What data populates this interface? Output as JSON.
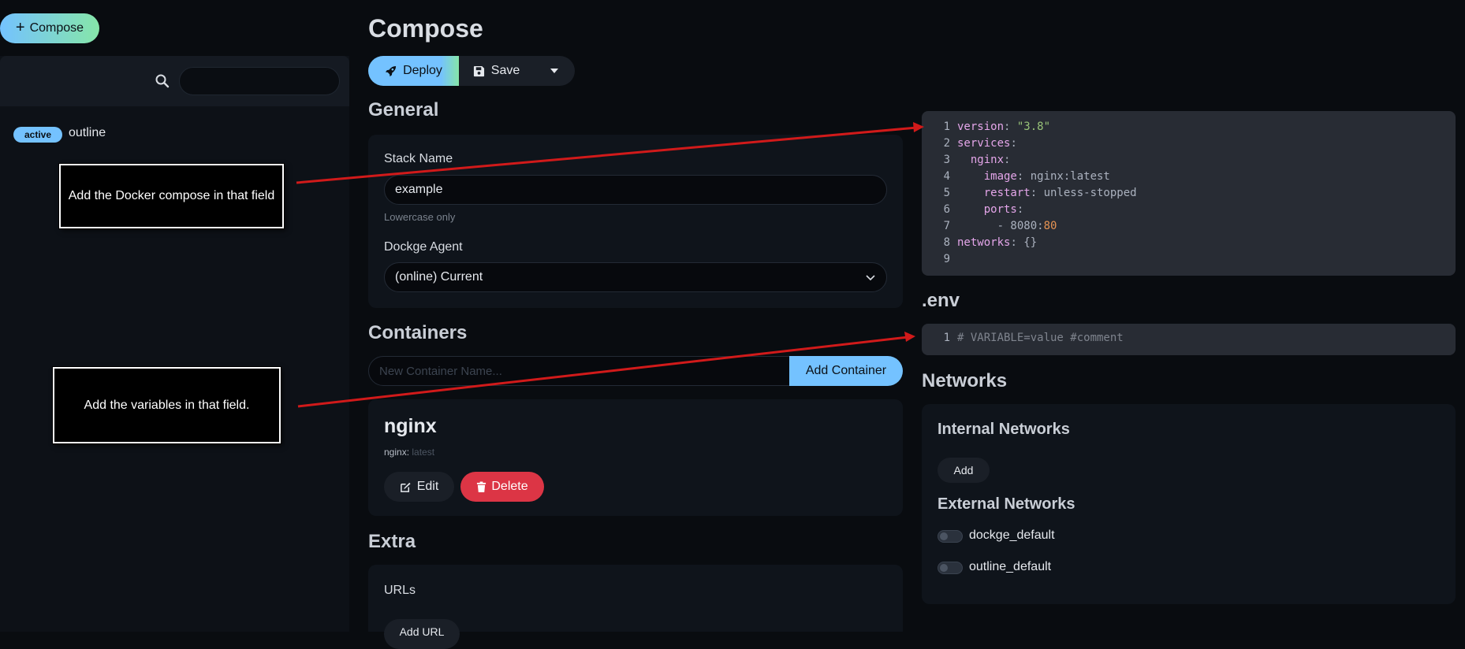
{
  "sidebar": {
    "compose_label": "Compose",
    "search_placeholder": "",
    "stacks": [
      {
        "status": "active",
        "name": "outline"
      }
    ]
  },
  "annotations": {
    "compose_note": "Add the Docker compose in that field",
    "env_note": "Add the variables in that field."
  },
  "main": {
    "title": "Compose",
    "toolbar": {
      "deploy_label": "Deploy",
      "save_label": "Save"
    },
    "general": {
      "title": "General",
      "stack_name_label": "Stack Name",
      "stack_name_value": "example",
      "stack_name_hint": "Lowercase only",
      "agent_label": "Dockge Agent",
      "agent_value": "(online) Current"
    },
    "containers": {
      "title": "Containers",
      "new_placeholder": "New Container Name...",
      "add_label": "Add Container",
      "items": [
        {
          "name": "nginx",
          "image_name": "nginx:",
          "image_tag": "latest",
          "edit_label": "Edit",
          "delete_label": "Delete"
        }
      ]
    },
    "extra": {
      "title": "Extra",
      "urls_label": "URLs",
      "add_url_label": "Add URL"
    }
  },
  "editor": {
    "line_numbers": [
      "1",
      "2",
      "3",
      "4",
      "5",
      "6",
      "7",
      "8",
      "9"
    ],
    "lines": [
      [
        {
          "t": "version",
          "c": "k"
        },
        {
          "t": ": ",
          "c": "p"
        },
        {
          "t": "\"3.8\"",
          "c": "s"
        }
      ],
      [
        {
          "t": "services",
          "c": "k"
        },
        {
          "t": ":",
          "c": "p"
        }
      ],
      [
        {
          "t": "  nginx",
          "c": "k"
        },
        {
          "t": ":",
          "c": "p"
        }
      ],
      [
        {
          "t": "    image",
          "c": "k"
        },
        {
          "t": ": nginx:latest",
          "c": "p"
        }
      ],
      [
        {
          "t": "    restart",
          "c": "k"
        },
        {
          "t": ": unless-stopped",
          "c": "p"
        }
      ],
      [
        {
          "t": "    ports",
          "c": "k"
        },
        {
          "t": ":",
          "c": "p"
        }
      ],
      [
        {
          "t": "      - 8080:",
          "c": "p"
        },
        {
          "t": "80",
          "c": "n"
        }
      ],
      [
        {
          "t": "networks",
          "c": "k"
        },
        {
          "t": ": {}",
          "c": "p"
        }
      ],
      []
    ]
  },
  "env": {
    "title": ".env",
    "line_number": "1",
    "line": "# VARIABLE=value #comment"
  },
  "networks": {
    "title": "Networks",
    "internal_title": "Internal Networks",
    "add_label": "Add",
    "external_title": "External Networks",
    "external": [
      {
        "name": "dockge_default",
        "enabled": false
      },
      {
        "name": "outline_default",
        "enabled": false
      }
    ]
  },
  "colors": {
    "accent": "#74c2ff",
    "accent_gradient_end": "#86e6a9",
    "danger": "#dc3545",
    "background": "#090c10",
    "arrow": "#d11a1a"
  }
}
